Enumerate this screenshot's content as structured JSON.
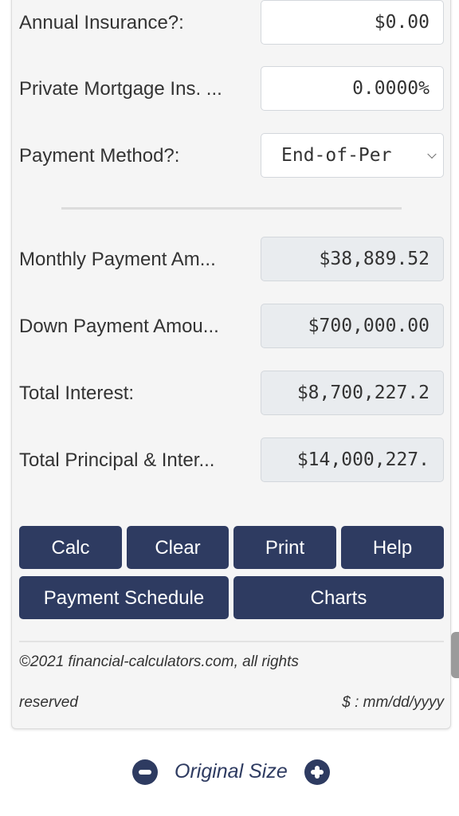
{
  "inputs": [
    {
      "label": "Annual Insurance?:",
      "value": "$0.00"
    },
    {
      "label": "Private Mortgage Ins. ...",
      "value": "0.0000%"
    },
    {
      "label": "Payment Method?:",
      "value": "End-of-Per"
    }
  ],
  "results": [
    {
      "label": "Monthly Payment Am...",
      "value": "$38,889.52"
    },
    {
      "label": "Down Payment Amou...",
      "value": "$700,000.00"
    },
    {
      "label": "Total Interest:",
      "value": "$8,700,227.2"
    },
    {
      "label": "Total Principal & Inter...",
      "value": "$14,000,227."
    }
  ],
  "buttons": {
    "calc": "Calc",
    "clear": "Clear",
    "print": "Print",
    "help": "Help",
    "payment_schedule": "Payment Schedule",
    "charts": "Charts"
  },
  "footer": {
    "copyright_line1": "©2021 financial-calculators.com, all rights",
    "copyright_line2": "reserved",
    "format": "$ : mm/dd/yyyy"
  },
  "zoom": {
    "label": "Original Size",
    "decrease_icon": "minus-circle-icon",
    "increase_icon": "plus-circle-icon"
  },
  "colors": {
    "button_bg": "#2e3b61",
    "readonly_bg": "#e9ecef",
    "panel_bg": "#f5f5f5"
  }
}
